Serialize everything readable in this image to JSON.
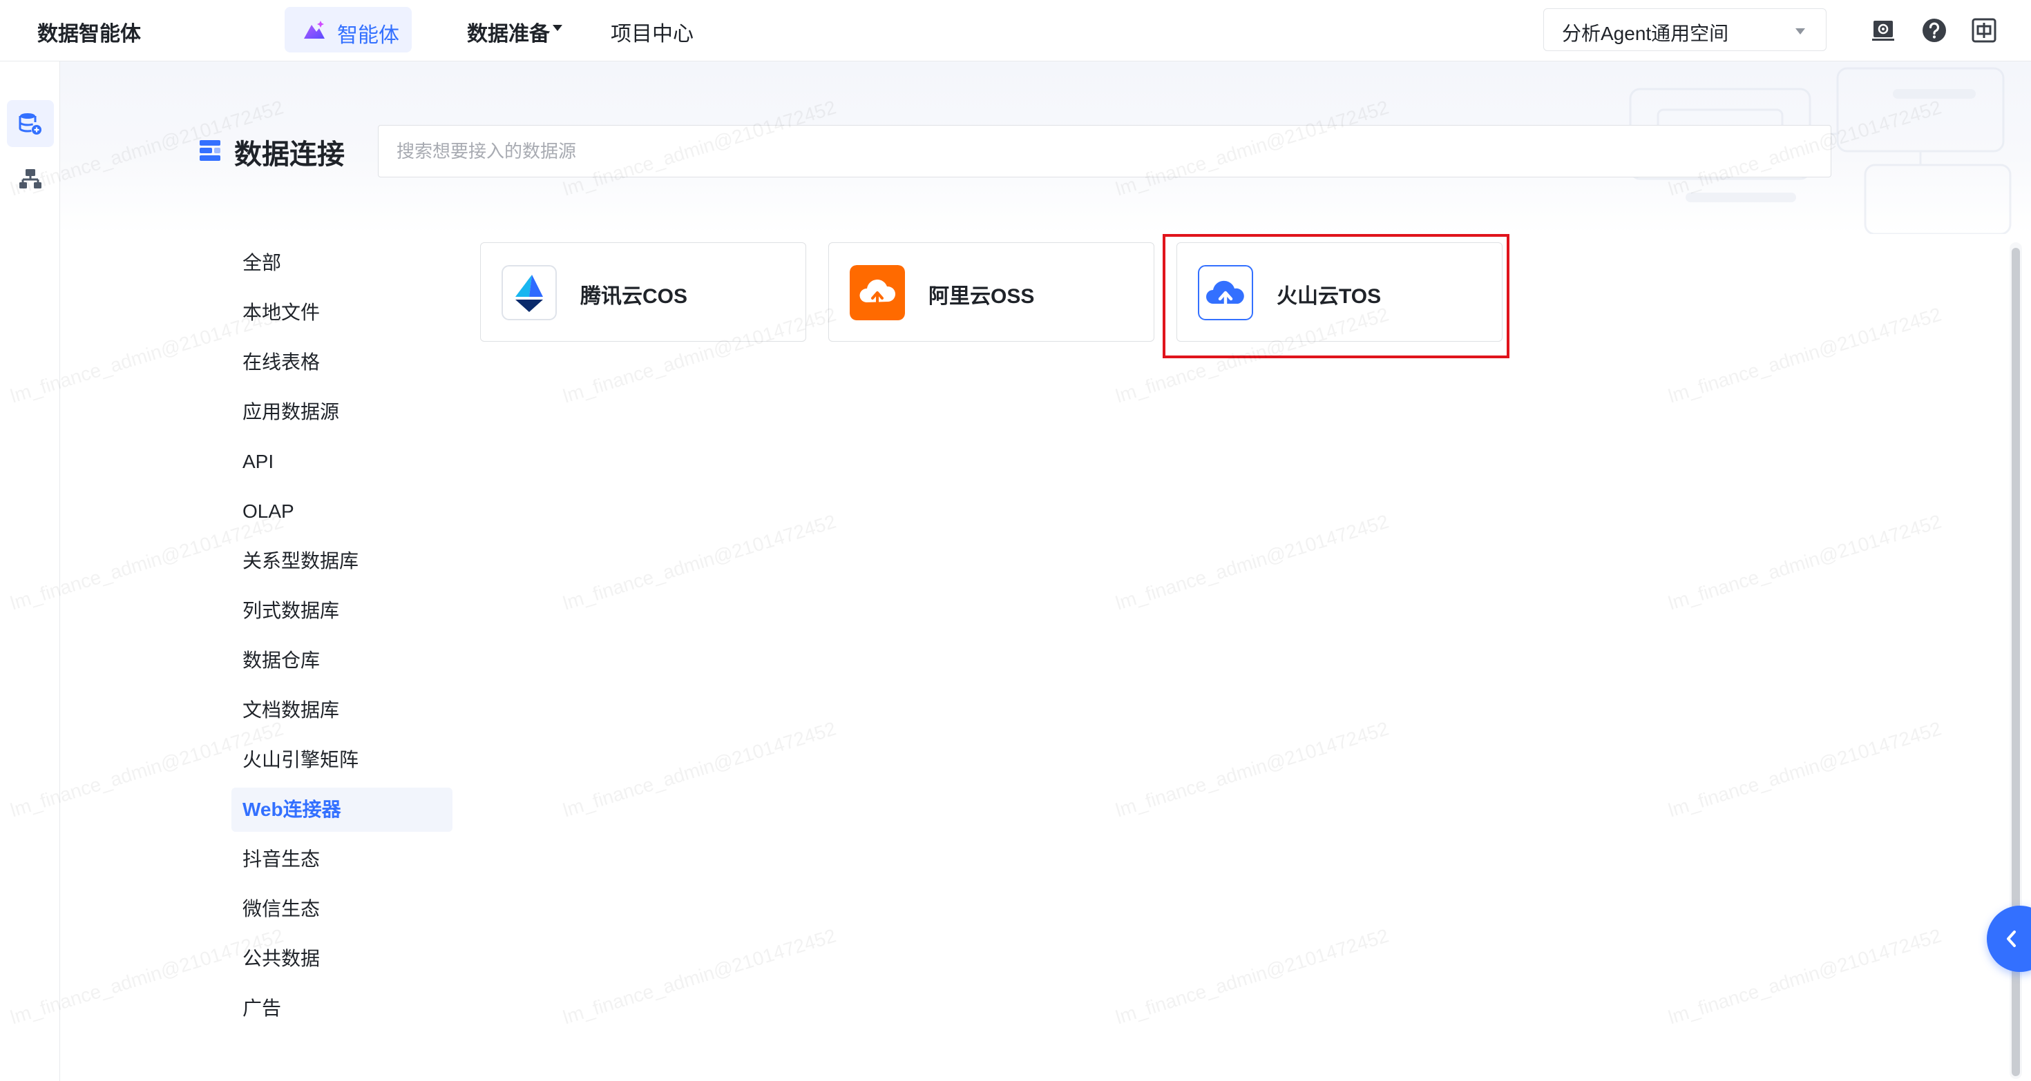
{
  "app": {
    "title": "数据智能体"
  },
  "topnav": {
    "agent_label": "智能体",
    "data_prep_label": "数据准备",
    "project_label": "项目中心"
  },
  "workspace": {
    "selected": "分析Agent通用空间"
  },
  "page": {
    "title": "数据连接",
    "search_placeholder": "搜索想要接入的数据源"
  },
  "categories": [
    "全部",
    "本地文件",
    "在线表格",
    "应用数据源",
    "API",
    "OLAP",
    "关系型数据库",
    "列式数据库",
    "数据仓库",
    "文档数据库",
    "火山引擎矩阵",
    "Web连接器",
    "抖音生态",
    "微信生态",
    "公共数据",
    "广告"
  ],
  "active_category": "Web连接器",
  "connectors": [
    {
      "name": "腾讯云COS",
      "icon": "tencent-cloud-cos-icon"
    },
    {
      "name": "阿里云OSS",
      "icon": "aliyun-oss-icon"
    },
    {
      "name": "火山云TOS",
      "icon": "volcengine-tos-icon"
    }
  ],
  "highlighted_connector": "火山云TOS",
  "watermark": "lm_finance_admin@2101472452",
  "colors": {
    "accent": "#3370ff",
    "highlight_box": "#e0141c",
    "aliyun_orange": "#ff6a00",
    "active_bg": "#eef2ff"
  }
}
